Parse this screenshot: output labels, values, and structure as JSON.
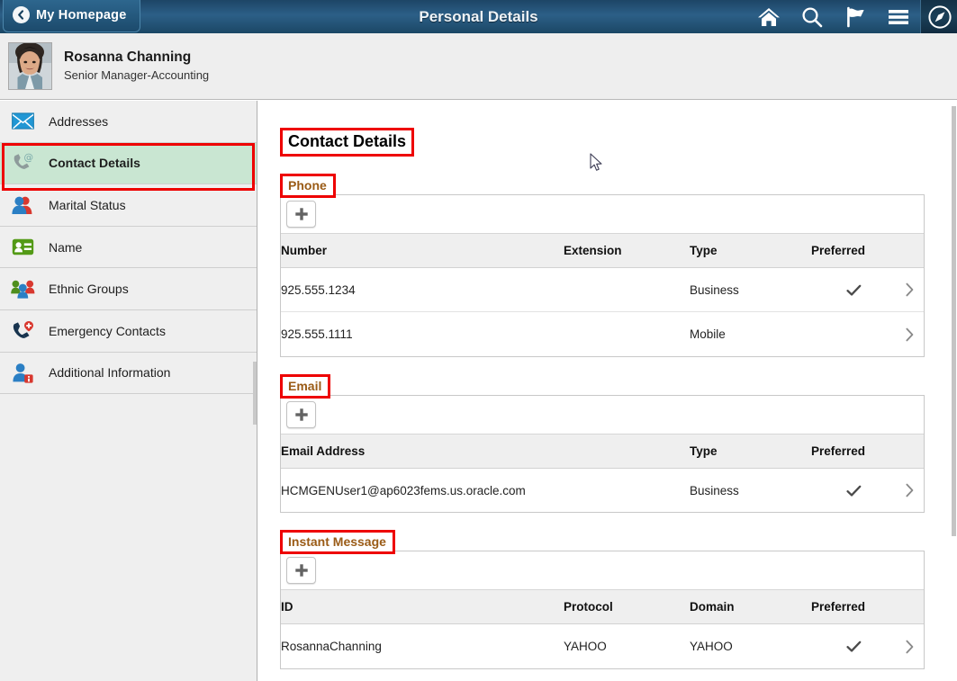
{
  "header": {
    "back_label": "My Homepage",
    "back_icon": "chevron-left-icon",
    "title": "Personal Details",
    "icons": [
      {
        "name": "home-icon",
        "label": "Home"
      },
      {
        "name": "search-icon",
        "label": "Search"
      },
      {
        "name": "flag-icon",
        "label": "Notifications"
      },
      {
        "name": "hamburger-menu-icon",
        "label": "Actions Menu"
      },
      {
        "name": "navbar-compass-icon",
        "label": "NavBar"
      }
    ]
  },
  "person": {
    "name": "Rosanna Channing",
    "job_title": "Senior Manager-Accounting",
    "avatar_alt": "Employee photo"
  },
  "sidebar": {
    "items": [
      {
        "label": "Addresses",
        "icon": "envelope-icon",
        "active": false
      },
      {
        "label": "Contact Details",
        "icon": "phone-at-icon",
        "active": true
      },
      {
        "label": "Marital Status",
        "icon": "two-people-icon",
        "active": false
      },
      {
        "label": "Name",
        "icon": "id-card-icon",
        "active": false
      },
      {
        "label": "Ethnic Groups",
        "icon": "people-group-icon",
        "active": false
      },
      {
        "label": "Emergency Contacts",
        "icon": "phone-medical-icon",
        "active": false
      },
      {
        "label": "Additional Information",
        "icon": "person-info-icon",
        "active": false
      }
    ]
  },
  "main": {
    "page_title": "Contact Details",
    "add_button_label": "+",
    "sections": [
      {
        "label": "Phone",
        "columns": [
          "Number",
          "Extension",
          "Type",
          "Preferred"
        ],
        "rows": [
          {
            "c0": "925.555.1234",
            "c1": "",
            "c2": "Business",
            "preferred": true
          },
          {
            "c0": "925.555.1111",
            "c1": "",
            "c2": "Mobile",
            "preferred": false
          }
        ]
      },
      {
        "label": "Email",
        "columns": [
          "Email Address",
          "Type",
          "Preferred"
        ],
        "rows": [
          {
            "c0": "HCMGENUser1@ap6023fems.us.oracle.com",
            "c1": "Business",
            "preferred": true
          }
        ]
      },
      {
        "label": "Instant Message",
        "columns": [
          "ID",
          "Protocol",
          "Domain",
          "Preferred"
        ],
        "rows": [
          {
            "c0": "RosannaChanning",
            "c1": "YAHOO",
            "c2": "YAHOO",
            "preferred": true
          }
        ]
      }
    ]
  },
  "colors": {
    "header_blue": "#23567a",
    "active_green": "#c9e6d2",
    "annotation_red": "#ee0000",
    "section_label_brown": "#9a5b16"
  }
}
